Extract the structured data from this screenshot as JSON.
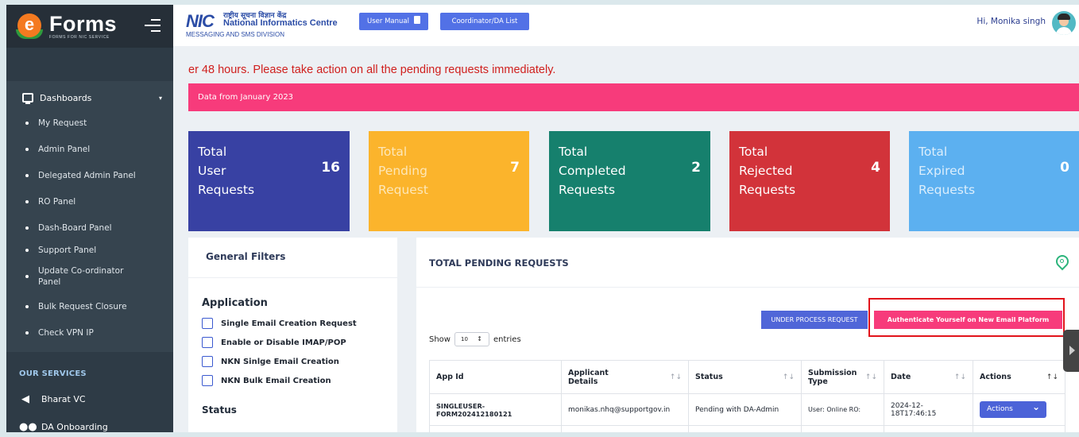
{
  "brand": {
    "name": "Forms",
    "tagline": "FORMS FOR NIC SERVICE"
  },
  "header": {
    "org_short": "NIC",
    "org_hindi": "राष्ट्रीय सूचना विज्ञान केंद्र",
    "org_name": "National Informatics Centre",
    "division": "MESSAGING AND SMS DIVISION",
    "user_manual_label": "User Manual",
    "coordinator_label": "Coordinator/DA List",
    "greeting": "Hi, Monika singh"
  },
  "sidebar": {
    "dashboards_label": "Dashboards",
    "items": [
      {
        "label": "My Request"
      },
      {
        "label": "Admin Panel"
      },
      {
        "label": "Delegated Admin Panel"
      },
      {
        "label": "RO Panel"
      },
      {
        "label": "Dash-Board Panel"
      },
      {
        "label": "Support Panel"
      },
      {
        "label": "Update Co-ordinator Panel"
      },
      {
        "label": "Bulk Request Closure"
      },
      {
        "label": "Check VPN IP"
      }
    ],
    "services_heading": "OUR SERVICES",
    "services": [
      {
        "label": "Bharat VC",
        "icon": "share-icon"
      },
      {
        "label": "DA Onboarding",
        "icon": "users-icon"
      }
    ]
  },
  "main": {
    "ticker_text": "er 48 hours. Please take action on all the pending requests immediately.",
    "banner_text": "Data from January 2023",
    "cards": [
      {
        "lines": [
          "Total",
          "User",
          "Requests"
        ],
        "count": "16",
        "color": "#3841a3"
      },
      {
        "lines": [
          "Total",
          "Pending",
          "Request"
        ],
        "count": "7",
        "color": "#fbb42c"
      },
      {
        "lines": [
          "Total",
          "Completed",
          "Requests"
        ],
        "count": "2",
        "color": "#16806d"
      },
      {
        "lines": [
          "Total",
          "Rejected",
          "Requests"
        ],
        "count": "4",
        "color": "#d2333a"
      },
      {
        "lines": [
          "Total",
          "Expired",
          "Requests"
        ],
        "count": "0",
        "color": "#5cb0f0"
      }
    ],
    "filters": {
      "title": "General Filters",
      "application_heading": "Application",
      "options": [
        "Single Email Creation Request",
        "Enable or Disable IMAP/POP",
        "NKN Sinlge Email Creation",
        "NKN Bulk Email Creation"
      ],
      "status_heading": "Status"
    },
    "pending": {
      "title": "TOTAL PENDING REQUESTS",
      "under_process_label": "UNDER PROCESS REQUEST",
      "authenticate_label": "Authenticate Yourself on New Email Platform",
      "show_label": "Show",
      "entries_value": "10",
      "entries_label": "entries",
      "columns": [
        "App Id",
        "Applicant Details",
        "Status",
        "Submission Type",
        "Date",
        "Actions"
      ],
      "rows": [
        {
          "app_id": "SINGLEUSER-FORM202412180121",
          "applicant": "monikas.nhq@supportgov.in",
          "status": "Pending with DA-Admin",
          "submission": "User: Online RO:",
          "date": "2024-12-18T17:46:15",
          "action": "Actions"
        }
      ]
    }
  }
}
